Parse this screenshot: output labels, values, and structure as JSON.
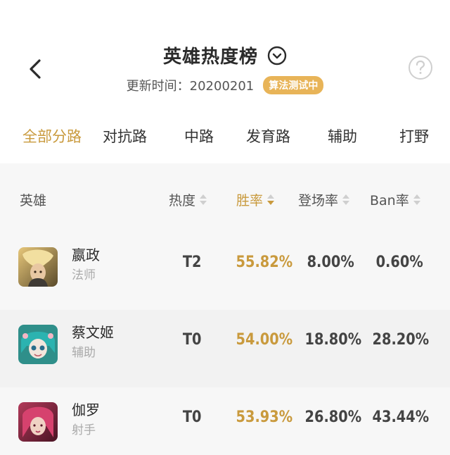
{
  "header": {
    "title": "英雄热度榜",
    "update_text": "更新时间：20200201",
    "badge": "算法测试中"
  },
  "tabs": [
    {
      "label": "全部分路",
      "active": true
    },
    {
      "label": "对抗路",
      "active": false
    },
    {
      "label": "中路",
      "active": false
    },
    {
      "label": "发育路",
      "active": false
    },
    {
      "label": "辅助",
      "active": false
    },
    {
      "label": "打野",
      "active": false
    }
  ],
  "table": {
    "columns": [
      {
        "label": "英雄",
        "sortable": false
      },
      {
        "label": "热度",
        "sortable": true,
        "sorted": false
      },
      {
        "label": "胜率",
        "sortable": true,
        "sorted": "desc"
      },
      {
        "label": "登场率",
        "sortable": true,
        "sorted": false
      },
      {
        "label": "Ban率",
        "sortable": true,
        "sorted": false
      }
    ],
    "rows": [
      {
        "name": "嬴政",
        "role": "法师",
        "heat": "T2",
        "win_rate": "55.82%",
        "pick_rate": "8.00%",
        "ban_rate": "0.60%"
      },
      {
        "name": "蔡文姬",
        "role": "辅助",
        "heat": "T0",
        "win_rate": "54.00%",
        "pick_rate": "18.80%",
        "ban_rate": "28.20%"
      },
      {
        "name": "伽罗",
        "role": "射手",
        "heat": "T0",
        "win_rate": "53.93%",
        "pick_rate": "26.80%",
        "ban_rate": "43.44%"
      }
    ]
  },
  "icons": {
    "back": "chevron-left-icon",
    "title_dropdown": "chevron-down-circle-icon",
    "help": "question-circle-icon"
  },
  "colors": {
    "accent": "#c99a3d",
    "badge_bg": "#e8b458",
    "table_bg": "#f7f7f7"
  }
}
